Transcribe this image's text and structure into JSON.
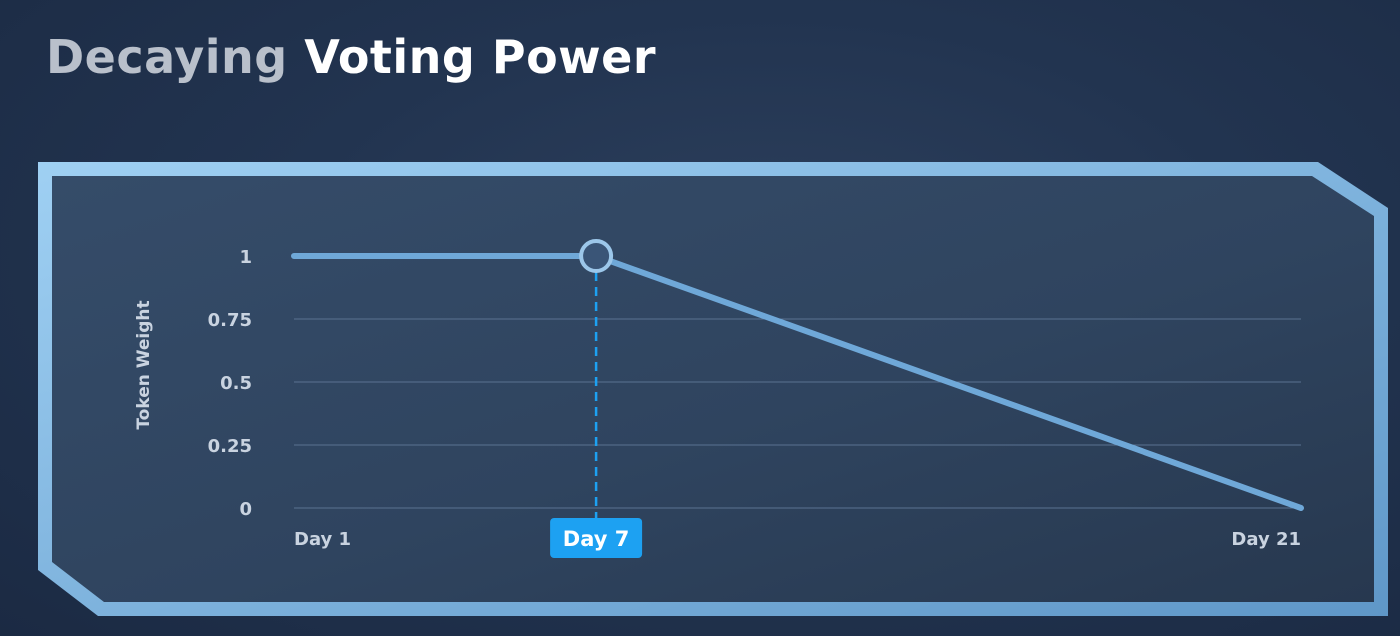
{
  "title": {
    "part1": "Decaying",
    "part2": "Voting Power"
  },
  "chart_data": {
    "type": "line",
    "title": "Decaying Voting Power",
    "xlabel": "",
    "ylabel": "Token Weight",
    "x_tick_labels": [
      "Day 1",
      "Day 7",
      "Day 21"
    ],
    "y_tick_labels": [
      "1",
      "0.75",
      "0.5",
      "0.25",
      "0"
    ],
    "y_ticks": [
      1,
      0.75,
      0.5,
      0.25,
      0
    ],
    "xlim": [
      1,
      21
    ],
    "ylim": [
      0,
      1
    ],
    "highlight_x_label": "Day 7",
    "series": [
      {
        "x": [
          1,
          7,
          21
        ],
        "y": [
          1,
          1,
          0
        ]
      }
    ],
    "grid": true,
    "colors": {
      "line": "#6fa8d8",
      "frame": "#8cc2ea",
      "highlight": "#1da1f2",
      "marker_fill": "#3a5577"
    }
  }
}
